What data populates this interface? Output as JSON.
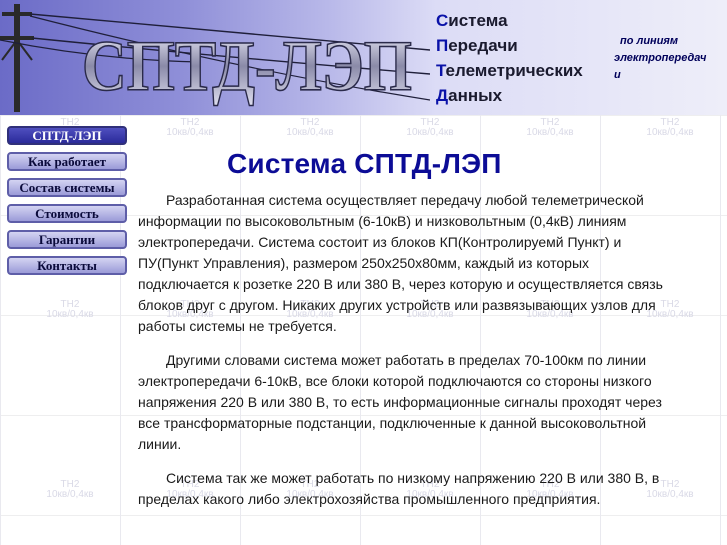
{
  "header": {
    "logo_text": "СПТД-ЛЭП",
    "title_lines": [
      {
        "cap": "С",
        "rest": "истема"
      },
      {
        "cap": "П",
        "rest": "ередачи"
      },
      {
        "cap": "Т",
        "rest": "елеметрических"
      },
      {
        "cap": "Д",
        "rest": "анных"
      }
    ],
    "subtitle_lines": [
      "по линиям",
      "электропередач",
      "и"
    ]
  },
  "nav": {
    "items": [
      {
        "label": "СПТД-ЛЭП",
        "active": true
      },
      {
        "label": "Как работает",
        "active": false
      },
      {
        "label": "Состав системы",
        "active": false
      },
      {
        "label": "Стоимость",
        "active": false
      },
      {
        "label": "Гарантии",
        "active": false
      },
      {
        "label": "Контакты",
        "active": false
      }
    ]
  },
  "main": {
    "title": "Система СПТД-ЛЭП",
    "paragraphs": [
      "Разработанная система осуществляет передачу любой телеметрической информации по высоковольтным (6-10кВ) и низковольтным (0,4кВ) линиям электропередачи. Система состоит из блоков КП(Контролируемй Пункт) и ПУ(Пункт Управления), размером 250х250х80мм, каждый из которых подключается к розетке 220 В или 380 В, через которую и осуществляется связь блоков друг с другом. Никаких других устройств или развязывающих узлов для работы системы не требуется.",
      "Другими словами система может работать в пределах 70-100км по линии электропередачи 6-10кВ, все блоки которой подключаются со стороны низкого напряжения 220 В или 380 В, то есть информационные сигналы проходят через все трансформаторные подстанции, подключенные к данной высоковольтной линии.",
      "Система так же может работать по низкому напряжению 220 В или 380 В, в пределах какого либо электрохозяйства промышленного предприятия."
    ]
  },
  "background": {
    "watermark_line1": "ТН2",
    "watermark_line2": "10кв/0,4кв"
  },
  "colors": {
    "header_gradient_start": "#6b6bc7",
    "title_color": "#0c0c96",
    "nav_active_bg": "#2a2a9a",
    "nav_bg": "#9b9bd8"
  }
}
